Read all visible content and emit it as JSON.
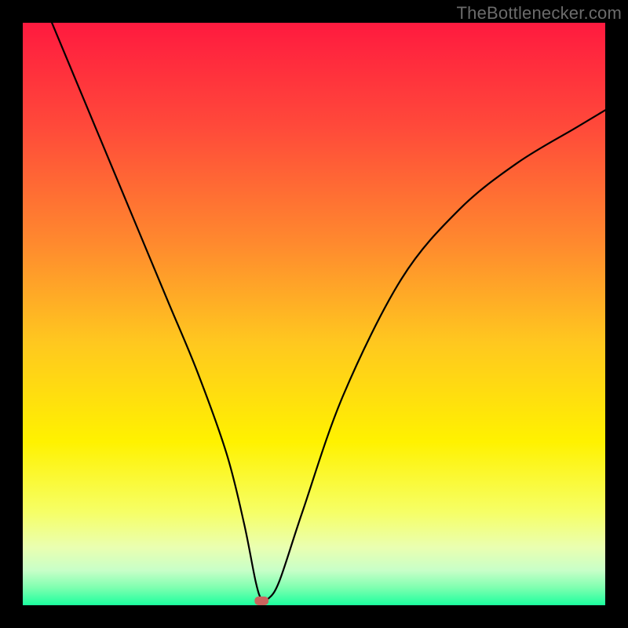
{
  "watermark": "TheBottlenecker.com",
  "chart_data": {
    "type": "line",
    "title": "",
    "xlabel": "",
    "ylabel": "",
    "xlim": [
      0,
      100
    ],
    "ylim": [
      0,
      100
    ],
    "grid": false,
    "series": [
      {
        "name": "curve",
        "color": "#000000",
        "x": [
          5,
          10,
          15,
          20,
          25,
          30,
          35,
          38,
          40,
          41,
          42,
          44,
          48,
          55,
          65,
          75,
          85,
          95,
          100
        ],
        "y": [
          100,
          88,
          76,
          64,
          52,
          40,
          26,
          14,
          4,
          1,
          1,
          4,
          16,
          36,
          56,
          68,
          76,
          82,
          85
        ]
      }
    ],
    "marker": {
      "x": 41,
      "y": 0,
      "w": 2.4,
      "h": 1.5,
      "color": "#c9645e"
    },
    "background_gradient": {
      "stops": [
        {
          "offset": 0.0,
          "color": "#ff1a3f"
        },
        {
          "offset": 0.18,
          "color": "#ff4a3a"
        },
        {
          "offset": 0.38,
          "color": "#ff8a2e"
        },
        {
          "offset": 0.55,
          "color": "#ffc81f"
        },
        {
          "offset": 0.72,
          "color": "#fff200"
        },
        {
          "offset": 0.84,
          "color": "#f6ff66"
        },
        {
          "offset": 0.9,
          "color": "#eaffb0"
        },
        {
          "offset": 0.94,
          "color": "#c8ffc8"
        },
        {
          "offset": 0.97,
          "color": "#7effb0"
        },
        {
          "offset": 1.0,
          "color": "#1cff9e"
        }
      ]
    }
  }
}
